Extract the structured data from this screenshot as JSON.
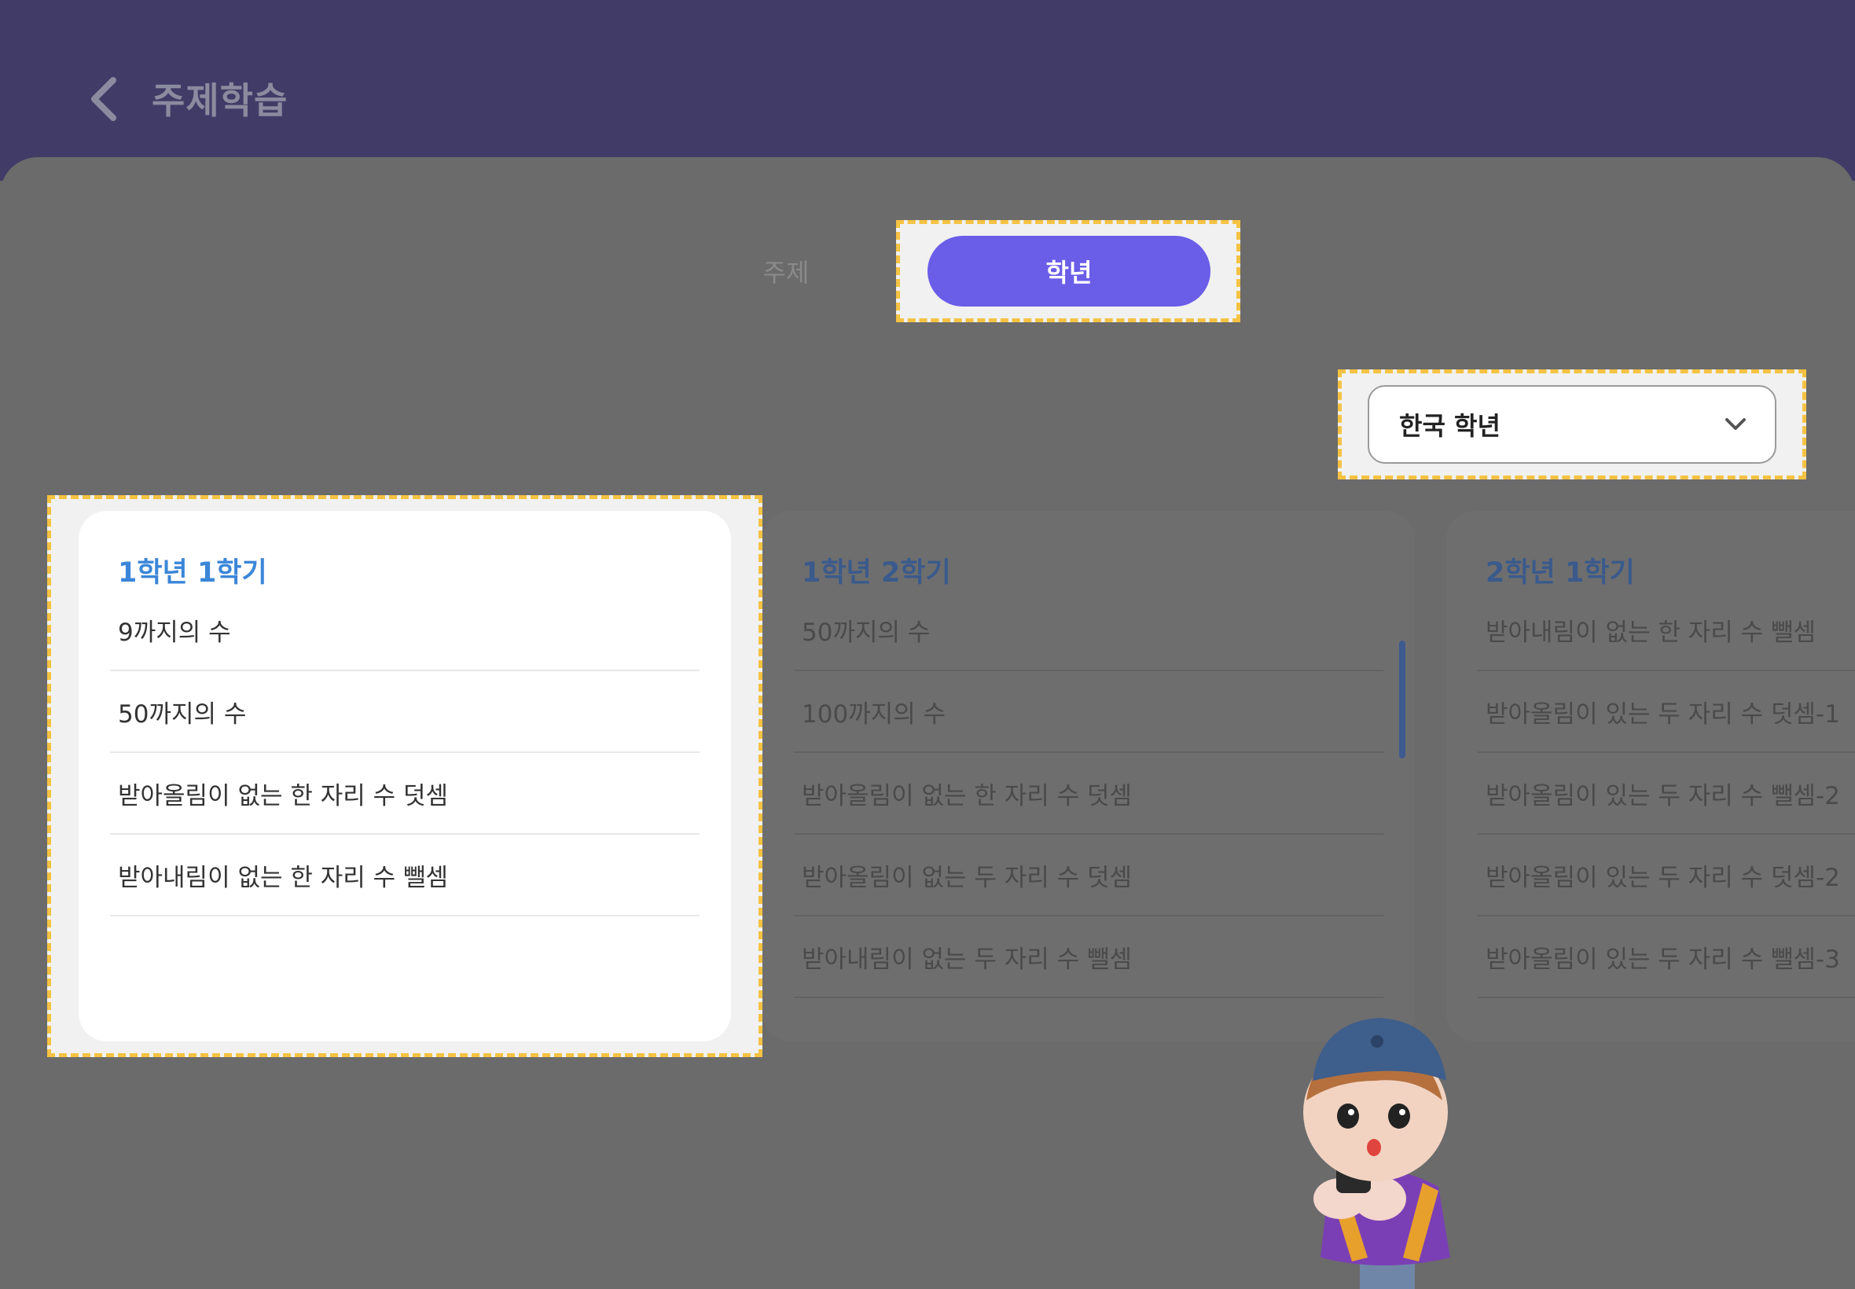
{
  "header": {
    "title": "주제학습",
    "back_icon": "chevron-left-icon"
  },
  "tabs": [
    {
      "label": "주제",
      "active": false
    },
    {
      "label": "학년",
      "active": true
    }
  ],
  "dropdown": {
    "value": "한국 학년",
    "icon": "chevron-down-icon"
  },
  "cards": [
    {
      "title": "1학년 1학기",
      "active": true,
      "items": [
        "9까지의 수",
        "50까지의 수",
        "받아올림이 없는 한 자리 수 덧셈",
        "받아내림이 없는 한 자리 수 뺄셈"
      ]
    },
    {
      "title": "1학년 2학기",
      "active": false,
      "items": [
        "50까지의 수",
        "100까지의 수",
        "받아올림이 없는 한 자리 수 덧셈",
        "받아올림이 없는 두 자리 수 덧셈",
        "받아내림이 없는 두 자리 수 뺄셈"
      ]
    },
    {
      "title": "2학년 1학기",
      "active": false,
      "items": [
        "받아내림이 없는 한 자리 수 뺄셈",
        "받아올림이 있는 두 자리 수 덧셈-1",
        "받아올림이 있는 두 자리 수 뺄셈-2",
        "받아올림이 있는 두 자리 수 덧셈-2",
        "받아올림이 있는 두 자리 수 뺄셈-3"
      ]
    }
  ],
  "colors": {
    "header_bg": "#413c67",
    "overlay_bg": "#6b6b6b",
    "accent": "#6a5de8",
    "card_title": "#3b86d8",
    "highlight_border": "#f5c242"
  }
}
